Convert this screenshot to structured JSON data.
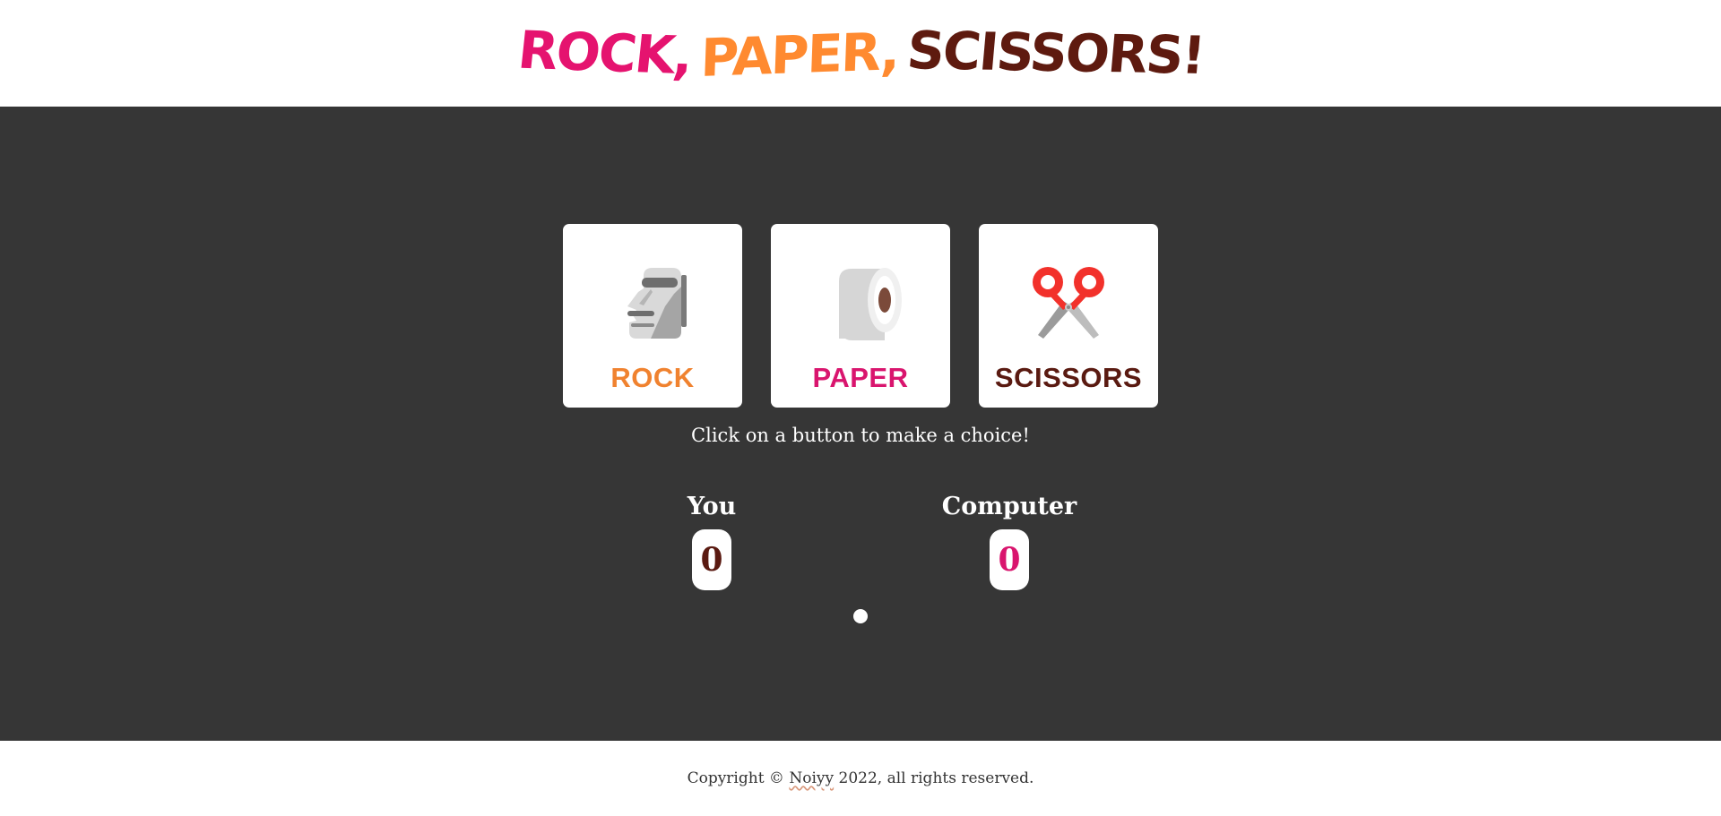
{
  "header": {
    "title_word_1": "ROCK,",
    "title_word_2": "PAPER,",
    "title_word_3": "SCISSORS!",
    "colors": {
      "pink": "#E5136F",
      "orange": "#FF8A30",
      "brown": "#5E1A0F"
    }
  },
  "choices": [
    {
      "label": "ROCK",
      "icon": "moai-statue-icon",
      "color": "#F0822F"
    },
    {
      "label": "PAPER",
      "icon": "toilet-paper-roll-icon",
      "color": "#D9156E"
    },
    {
      "label": "SCISSORS",
      "icon": "scissors-icon",
      "color": "#5A1A11"
    }
  ],
  "instruction": "Click on a button to make a choice!",
  "scoreboard": {
    "you": {
      "name": "You",
      "score": "0",
      "color": "#5A1A11"
    },
    "computer": {
      "name": "Computer",
      "score": "0",
      "color": "#D9156E"
    }
  },
  "footer": {
    "prefix": "Copyright © ",
    "author": "Noiyy",
    "suffix": " 2022, all rights reserved."
  },
  "colors": {
    "main_bg": "#363636",
    "card_bg": "#FFFFFF"
  }
}
